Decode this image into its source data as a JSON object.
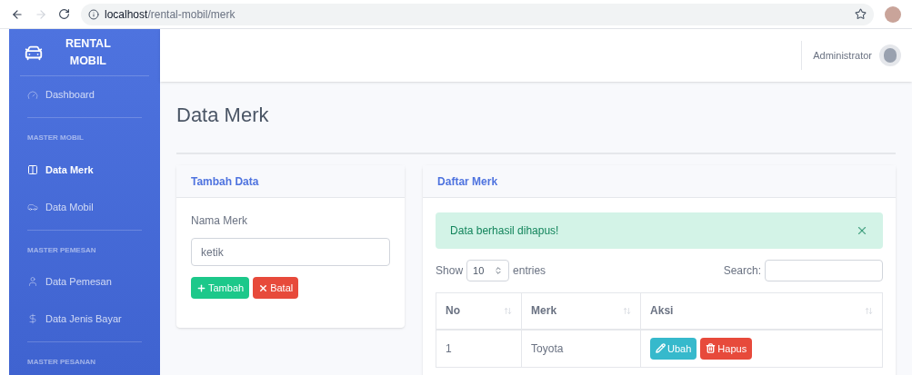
{
  "browser": {
    "url_host": "localhost",
    "url_path": "/rental-mobil/merk"
  },
  "sidebar": {
    "brand": [
      "RENTAL",
      "MOBIL"
    ],
    "items": [
      {
        "kind": "link",
        "label": "Dashboard",
        "selected": false
      },
      {
        "kind": "divider"
      },
      {
        "kind": "heading",
        "label": "MASTER MOBIL"
      },
      {
        "kind": "link",
        "label": "Data Merk",
        "selected": true
      },
      {
        "kind": "link",
        "label": "Data Mobil",
        "selected": false
      },
      {
        "kind": "divider"
      },
      {
        "kind": "heading",
        "label": "MASTER PEMESAN"
      },
      {
        "kind": "link",
        "label": "Data Pemesan",
        "selected": false
      },
      {
        "kind": "link",
        "label": "Data Jenis Bayar",
        "selected": false
      },
      {
        "kind": "divider"
      },
      {
        "kind": "heading",
        "label": "MASTER PESANAN"
      }
    ]
  },
  "topbar": {
    "user": "Administrator"
  },
  "page_title": "Data Merk",
  "form_card": {
    "title": "Tambah Data",
    "field_label": "Nama Merk",
    "field_placeholder": "ketik",
    "buttons": [
      {
        "kind": "add",
        "label": "Tambah"
      },
      {
        "kind": "cancel",
        "label": "Batal"
      }
    ]
  },
  "list_card": {
    "title": "Daftar Merk",
    "alert": "Data berhasil dihapus!",
    "show_label": "Show",
    "page_size": "10",
    "entries_label": "entries",
    "search_label": "Search:",
    "columns": [
      "No",
      "Merk",
      "Aksi"
    ],
    "rows": [
      {
        "no": "1",
        "merk": "Toyota",
        "actions": [
          {
            "kind": "edit",
            "label": "Ubah"
          },
          {
            "kind": "delete",
            "label": "Hapus"
          }
        ]
      }
    ]
  }
}
